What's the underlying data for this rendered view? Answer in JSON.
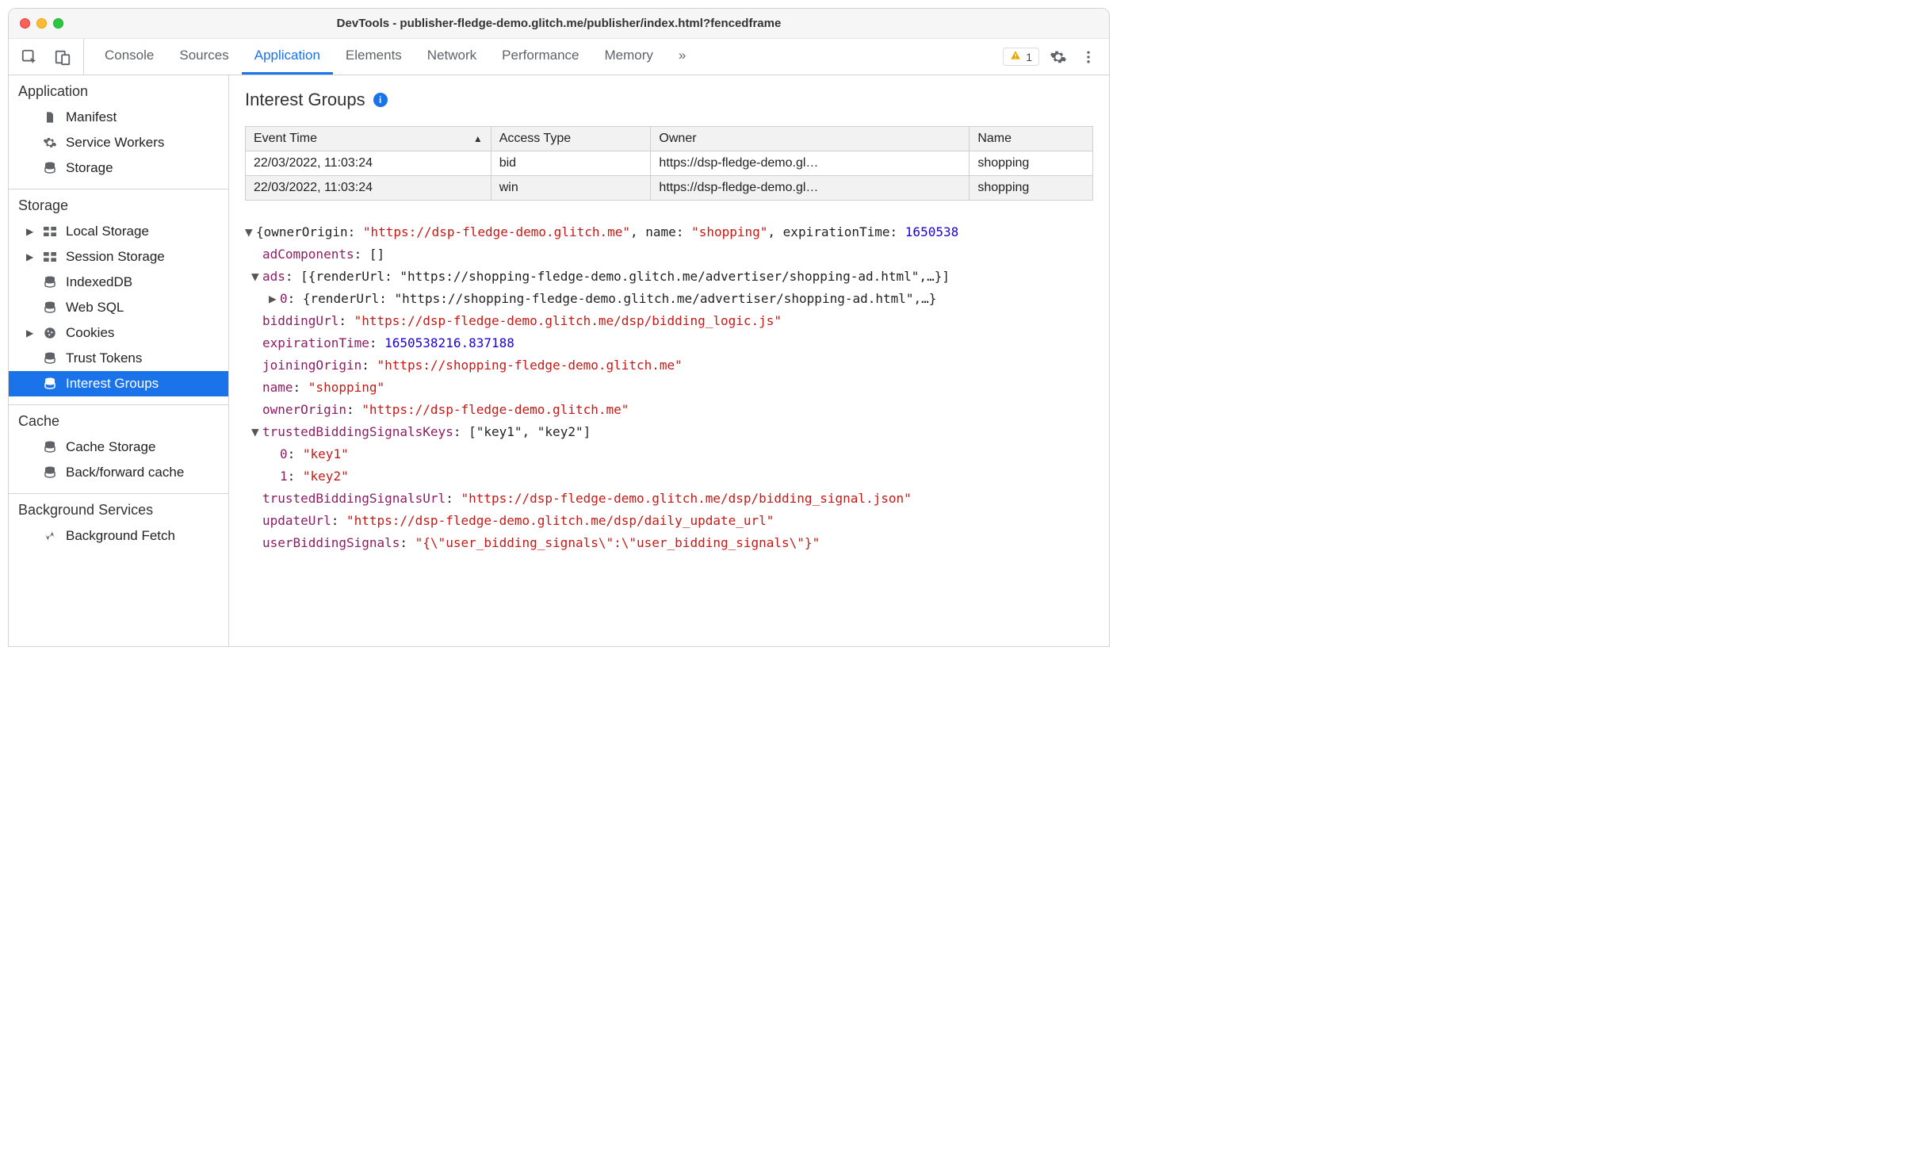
{
  "window": {
    "title": "DevTools - publisher-fledge-demo.glitch.me/publisher/index.html?fencedframe"
  },
  "toolbar": {
    "tabs": [
      "Console",
      "Sources",
      "Application",
      "Elements",
      "Network",
      "Performance",
      "Memory"
    ],
    "activeTab": "Application",
    "warnCount": "1",
    "moreGlyph": "»"
  },
  "sidebar": {
    "sections": [
      {
        "title": "Application",
        "items": [
          {
            "icon": "document-icon",
            "label": "Manifest",
            "caret": "none"
          },
          {
            "icon": "gear-icon",
            "label": "Service Workers",
            "caret": "none"
          },
          {
            "icon": "storage-icon",
            "label": "Storage",
            "caret": "none"
          }
        ]
      },
      {
        "title": "Storage",
        "items": [
          {
            "icon": "table-icon",
            "label": "Local Storage",
            "caret": "right"
          },
          {
            "icon": "table-icon",
            "label": "Session Storage",
            "caret": "right"
          },
          {
            "icon": "storage-icon",
            "label": "IndexedDB",
            "caret": "none"
          },
          {
            "icon": "storage-icon",
            "label": "Web SQL",
            "caret": "none"
          },
          {
            "icon": "cookie-icon",
            "label": "Cookies",
            "caret": "right"
          },
          {
            "icon": "storage-icon",
            "label": "Trust Tokens",
            "caret": "none"
          },
          {
            "icon": "storage-icon",
            "label": "Interest Groups",
            "caret": "none",
            "selected": true
          }
        ]
      },
      {
        "title": "Cache",
        "items": [
          {
            "icon": "storage-icon",
            "label": "Cache Storage",
            "caret": "none"
          },
          {
            "icon": "storage-icon",
            "label": "Back/forward cache",
            "caret": "none"
          }
        ]
      },
      {
        "title": "Background Services",
        "items": [
          {
            "icon": "up-down-icon",
            "label": "Background Fetch",
            "caret": "none"
          }
        ]
      }
    ]
  },
  "panel": {
    "title": "Interest Groups",
    "table": {
      "headers": [
        "Event Time",
        "Access Type",
        "Owner",
        "Name"
      ],
      "sortedCol": 0,
      "rows": [
        [
          "22/03/2022, 11:03:24",
          "bid",
          "https://dsp-fledge-demo.gl…",
          "shopping"
        ],
        [
          "22/03/2022, 11:03:24",
          "win",
          "https://dsp-fledge-demo.gl…",
          "shopping"
        ]
      ]
    },
    "detail": {
      "topline_prefix": "{ownerOrigin: ",
      "topline_owner": "\"https://dsp-fledge-demo.glitch.me\"",
      "topline_mid1": ", name: ",
      "topline_name": "\"shopping\"",
      "topline_mid2": ", expirationTime: ",
      "topline_exp": "1650538",
      "adComponents_key": "adComponents",
      "adComponents_val": "[]",
      "ads_key": "ads",
      "ads_line": "[{renderUrl: \"https://shopping-fledge-demo.glitch.me/advertiser/shopping-ad.html\",…}]",
      "ads0_key": "0",
      "ads0_line": "{renderUrl: \"https://shopping-fledge-demo.glitch.me/advertiser/shopping-ad.html\",…}",
      "biddingUrl_key": "biddingUrl",
      "biddingUrl_val": "\"https://dsp-fledge-demo.glitch.me/dsp/bidding_logic.js\"",
      "expirationTime_key": "expirationTime",
      "expirationTime_val": "1650538216.837188",
      "joiningOrigin_key": "joiningOrigin",
      "joiningOrigin_val": "\"https://shopping-fledge-demo.glitch.me\"",
      "name_key": "name",
      "name_val": "\"shopping\"",
      "ownerOrigin_key": "ownerOrigin",
      "ownerOrigin_val": "\"https://dsp-fledge-demo.glitch.me\"",
      "tbsk_key": "trustedBiddingSignalsKeys",
      "tbsk_line": "[\"key1\", \"key2\"]",
      "tbsk0_key": "0",
      "tbsk0_val": "\"key1\"",
      "tbsk1_key": "1",
      "tbsk1_val": "\"key2\"",
      "tbsu_key": "trustedBiddingSignalsUrl",
      "tbsu_val": "\"https://dsp-fledge-demo.glitch.me/dsp/bidding_signal.json\"",
      "updateUrl_key": "updateUrl",
      "updateUrl_val": "\"https://dsp-fledge-demo.glitch.me/dsp/daily_update_url\"",
      "ubs_key": "userBiddingSignals",
      "ubs_val": "\"{\\\"user_bidding_signals\\\":\\\"user_bidding_signals\\\"}\""
    }
  }
}
